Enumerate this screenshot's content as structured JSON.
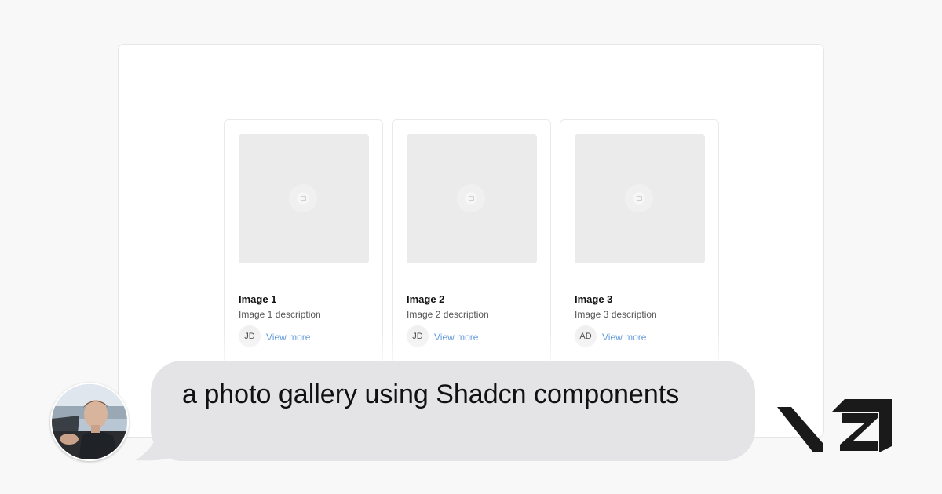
{
  "gallery": {
    "cards": [
      {
        "title": "Image 1",
        "description": "Image 1 description",
        "initials": "JD",
        "link": "View more"
      },
      {
        "title": "Image 2",
        "description": "Image 2 description",
        "initials": "JD",
        "link": "View more"
      },
      {
        "title": "Image 3",
        "description": "Image 3 description",
        "initials": "AD",
        "link": "View more"
      }
    ]
  },
  "chat": {
    "prompt": "a photo gallery using Shadcn components"
  },
  "icons": {
    "image_placeholder": "image-placeholder-icon",
    "brand_logo": "v0-logo"
  },
  "colors": {
    "link": "#4a8ad8",
    "bubble": "#e4e4e6",
    "logo": "#1a1a1a"
  }
}
